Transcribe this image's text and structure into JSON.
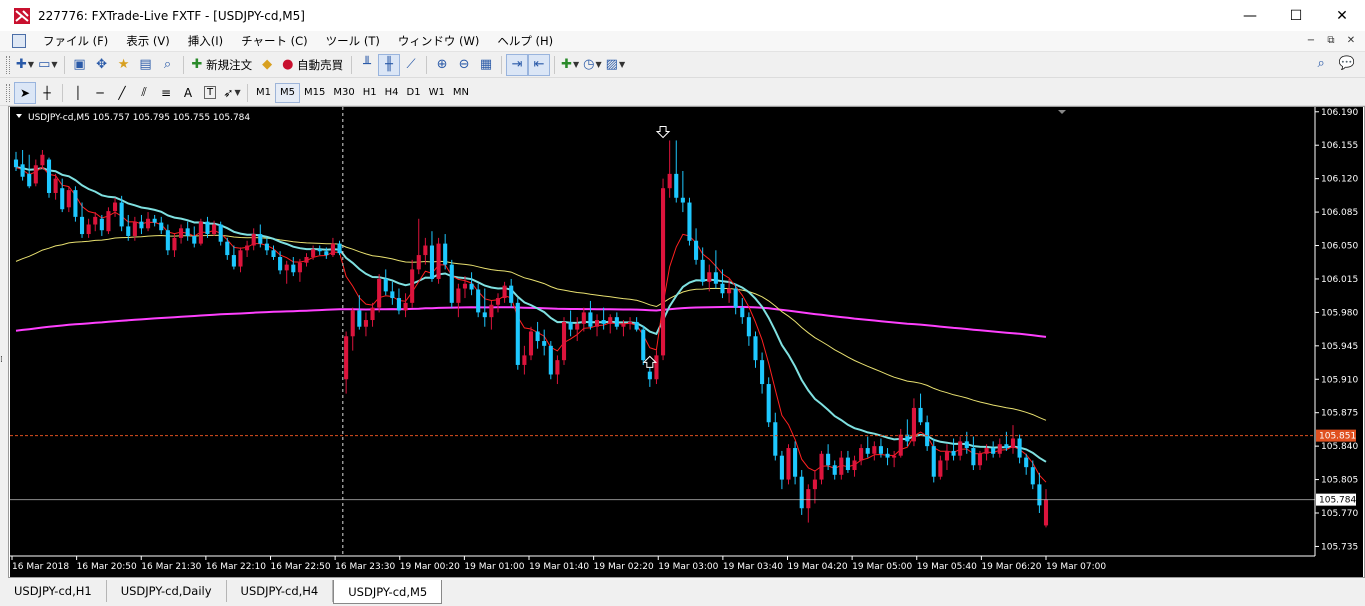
{
  "window": {
    "title": "227776: FXTrade-Live FXTF - [USDJPY-cd,M5]",
    "minimize": "—",
    "maximize": "☐",
    "close": "✕"
  },
  "menu": {
    "items": [
      "ファイル (F)",
      "表示 (V)",
      "挿入(I)",
      "チャート (C)",
      "ツール (T)",
      "ウィンドウ (W)",
      "ヘルプ (H)"
    ],
    "mdi": [
      "−",
      "⧉",
      "✕"
    ]
  },
  "toolbar1": {
    "new_order": "新規注文",
    "auto_trade": "自動売買"
  },
  "toolbar2": {
    "timeframes": [
      "M1",
      "M5",
      "M15",
      "M30",
      "H1",
      "H4",
      "D1",
      "W1",
      "MN"
    ],
    "selected": "M5",
    "tool_letters": [
      "A",
      "T"
    ]
  },
  "tabs": [
    "USDJPY-cd,H1",
    "USDJPY-cd,Daily",
    "USDJPY-cd,H4",
    "USDJPY-cd,M5"
  ],
  "active_tab": "USDJPY-cd,M5",
  "colors": {
    "background": "#000000",
    "bull": "#dc143c",
    "bear": "#1ec8ff",
    "ma_fast": "#ff2020",
    "ma_mid": "#7fe0e0",
    "ma_slow": "#e8e070",
    "ma_long": "#ff40ff",
    "bid_line": "#e05020",
    "ask_line": "#c8c8c8"
  },
  "chart_data": {
    "type": "candlestick",
    "header": "USDJPY-cd,M5  105.757 105.795 105.755 105.784",
    "ylim": [
      105.725,
      106.195
    ],
    "y_ticks": [
      "106.190",
      "106.155",
      "106.120",
      "106.085",
      "106.050",
      "106.015",
      "105.980",
      "105.945",
      "105.910",
      "105.875",
      "105.840",
      "105.805",
      "105.770",
      "105.735"
    ],
    "x_ticks": [
      "16 Mar 2018",
      "16 Mar 20:50",
      "16 Mar 21:30",
      "16 Mar 22:10",
      "16 Mar 22:50",
      "16 Mar 23:30",
      "19 Mar 00:20",
      "19 Mar 01:00",
      "19 Mar 01:40",
      "19 Mar 02:20",
      "19 Mar 03:00",
      "19 Mar 03:40",
      "19 Mar 04:20",
      "19 Mar 05:00",
      "19 Mar 05:40",
      "19 Mar 06:20",
      "19 Mar 07:00"
    ],
    "price_bid_label": "105.851",
    "price_bid": 105.851,
    "price_ask_label": "105.784",
    "price_ask": 105.784,
    "markers": {
      "down_arrow_price": 106.162,
      "up_arrow_price": 105.935
    },
    "candles": [
      [
        106.14,
        106.148,
        106.128,
        106.132
      ],
      [
        106.135,
        106.15,
        106.118,
        106.122
      ],
      [
        106.125,
        106.145,
        106.11,
        106.112
      ],
      [
        106.115,
        106.14,
        106.112,
        106.134
      ],
      [
        106.134,
        106.15,
        106.13,
        106.145
      ],
      [
        106.14,
        106.142,
        106.1,
        106.105
      ],
      [
        106.105,
        106.125,
        106.098,
        106.12
      ],
      [
        106.11,
        106.12,
        106.085,
        106.088
      ],
      [
        106.09,
        106.112,
        106.085,
        106.108
      ],
      [
        106.108,
        106.112,
        106.075,
        106.08
      ],
      [
        106.08,
        106.095,
        106.058,
        106.062
      ],
      [
        106.062,
        106.078,
        106.058,
        106.072
      ],
      [
        106.072,
        106.085,
        106.065,
        106.08
      ],
      [
        106.078,
        106.082,
        106.06,
        106.066
      ],
      [
        106.065,
        106.09,
        106.062,
        106.086
      ],
      [
        106.086,
        106.1,
        106.08,
        106.095
      ],
      [
        106.095,
        106.102,
        106.065,
        106.07
      ],
      [
        106.07,
        106.082,
        106.055,
        106.06
      ],
      [
        106.06,
        106.08,
        106.055,
        106.075
      ],
      [
        106.075,
        106.082,
        106.062,
        106.068
      ],
      [
        106.068,
        106.085,
        106.065,
        106.078
      ],
      [
        106.078,
        106.082,
        106.07,
        106.074
      ],
      [
        106.074,
        106.08,
        106.062,
        106.066
      ],
      [
        106.066,
        106.072,
        106.04,
        106.045
      ],
      [
        106.045,
        106.062,
        106.038,
        106.058
      ],
      [
        106.058,
        106.072,
        106.052,
        106.068
      ],
      [
        106.068,
        106.075,
        106.055,
        106.06
      ],
      [
        106.06,
        106.07,
        106.048,
        106.052
      ],
      [
        106.052,
        106.078,
        106.05,
        106.075
      ],
      [
        106.075,
        106.08,
        106.058,
        106.062
      ],
      [
        106.062,
        106.076,
        106.06,
        106.072
      ],
      [
        106.072,
        106.075,
        106.05,
        106.054
      ],
      [
        106.054,
        106.058,
        106.035,
        106.04
      ],
      [
        106.04,
        106.05,
        106.025,
        106.028
      ],
      [
        106.028,
        106.048,
        106.022,
        106.045
      ],
      [
        106.045,
        106.055,
        106.038,
        106.05
      ],
      [
        106.05,
        106.068,
        106.045,
        106.062
      ],
      [
        106.062,
        106.072,
        106.048,
        106.052
      ],
      [
        106.052,
        106.058,
        106.04,
        106.045
      ],
      [
        106.045,
        106.05,
        106.035,
        106.038
      ],
      [
        106.038,
        106.044,
        106.02,
        106.024
      ],
      [
        106.024,
        106.034,
        106.01,
        106.03
      ],
      [
        106.03,
        106.038,
        106.018,
        106.022
      ],
      [
        106.022,
        106.036,
        106.012,
        106.032
      ],
      [
        106.032,
        106.042,
        106.028,
        106.038
      ],
      [
        106.038,
        106.05,
        106.035,
        106.046
      ],
      [
        106.046,
        106.05,
        106.04,
        106.044
      ],
      [
        106.044,
        106.048,
        106.036,
        106.04
      ],
      [
        106.04,
        106.058,
        106.038,
        106.052
      ],
      [
        106.052,
        106.055,
        106.04,
        106.042
      ],
      [
        105.91,
        105.96,
        105.895,
        105.955
      ],
      [
        105.955,
        105.985,
        105.94,
        105.982
      ],
      [
        105.982,
        105.998,
        105.962,
        105.965
      ],
      [
        105.965,
        105.98,
        105.955,
        105.972
      ],
      [
        105.972,
        105.99,
        105.965,
        105.985
      ],
      [
        105.985,
        106.02,
        105.98,
        106.015
      ],
      [
        106.015,
        106.025,
        105.998,
        106.002
      ],
      [
        106.002,
        106.012,
        105.988,
        105.995
      ],
      [
        105.995,
        106.005,
        105.978,
        105.982
      ],
      [
        105.982,
        106.0,
        105.975,
        105.99
      ],
      [
        105.99,
        106.035,
        105.985,
        106.025
      ],
      [
        106.025,
        106.078,
        106.02,
        106.04
      ],
      [
        106.04,
        106.058,
        106.03,
        106.05
      ],
      [
        106.05,
        106.065,
        106.012,
        106.015
      ],
      [
        106.015,
        106.058,
        106.01,
        106.052
      ],
      [
        106.052,
        106.062,
        106.025,
        106.03
      ],
      [
        106.03,
        106.035,
        105.985,
        105.99
      ],
      [
        105.99,
        106.01,
        105.975,
        106.005
      ],
      [
        106.005,
        106.018,
        105.995,
        106.01
      ],
      [
        106.01,
        106.022,
        105.998,
        106.004
      ],
      [
        106.004,
        106.01,
        105.975,
        105.98
      ],
      [
        105.98,
        106.005,
        105.965,
        105.975
      ],
      [
        105.975,
        105.992,
        105.962,
        105.988
      ],
      [
        105.988,
        106.0,
        105.98,
        105.995
      ],
      [
        105.995,
        106.012,
        105.99,
        106.008
      ],
      [
        106.008,
        106.015,
        105.985,
        105.99
      ],
      [
        105.99,
        105.995,
        105.92,
        105.925
      ],
      [
        105.925,
        105.945,
        105.915,
        105.935
      ],
      [
        105.935,
        105.965,
        105.93,
        105.96
      ],
      [
        105.96,
        105.97,
        105.942,
        105.95
      ],
      [
        105.95,
        105.962,
        105.935,
        105.945
      ],
      [
        105.945,
        105.95,
        105.91,
        105.915
      ],
      [
        105.915,
        105.935,
        105.905,
        105.93
      ],
      [
        105.93,
        105.975,
        105.925,
        105.97
      ],
      [
        105.97,
        105.982,
        105.955,
        105.962
      ],
      [
        105.962,
        105.975,
        105.95,
        105.968
      ],
      [
        105.968,
        105.985,
        105.96,
        105.98
      ],
      [
        105.98,
        105.992,
        105.962,
        105.965
      ],
      [
        105.965,
        105.978,
        105.955,
        105.972
      ],
      [
        105.972,
        105.985,
        105.962,
        105.968
      ],
      [
        105.968,
        105.978,
        105.958,
        105.975
      ],
      [
        105.975,
        105.98,
        105.962,
        105.965
      ],
      [
        105.965,
        105.972,
        105.955,
        105.968
      ],
      [
        105.968,
        105.975,
        105.962,
        105.97
      ],
      [
        105.97,
        105.975,
        105.96,
        105.962
      ],
      [
        105.962,
        105.966,
        105.925,
        105.93
      ],
      [
        105.918,
        105.922,
        105.902,
        105.91
      ],
      [
        105.91,
        105.94,
        105.905,
        105.935
      ],
      [
        105.935,
        106.12,
        105.93,
        106.11
      ],
      [
        106.11,
        106.16,
        106.1,
        106.125
      ],
      [
        106.125,
        106.16,
        106.095,
        106.1
      ],
      [
        106.1,
        106.128,
        106.085,
        106.095
      ],
      [
        106.095,
        106.1,
        106.05,
        106.055
      ],
      [
        106.055,
        106.068,
        106.03,
        106.035
      ],
      [
        106.035,
        106.048,
        106.008,
        106.012
      ],
      [
        106.012,
        106.03,
        106.002,
        106.022
      ],
      [
        106.022,
        106.045,
        106.005,
        106.01
      ],
      [
        106.01,
        106.025,
        105.995,
        106.0
      ],
      [
        106.0,
        106.015,
        105.99,
        106.005
      ],
      [
        106.005,
        106.01,
        105.978,
        105.985
      ],
      [
        105.985,
        105.995,
        105.968,
        105.975
      ],
      [
        105.975,
        105.98,
        105.945,
        105.955
      ],
      [
        105.955,
        105.96,
        105.922,
        105.93
      ],
      [
        105.93,
        105.938,
        105.895,
        105.905
      ],
      [
        105.905,
        105.912,
        105.86,
        105.865
      ],
      [
        105.865,
        105.875,
        105.825,
        105.83
      ],
      [
        105.83,
        105.835,
        105.795,
        105.805
      ],
      [
        105.805,
        105.842,
        105.8,
        105.838
      ],
      [
        105.838,
        105.845,
        105.8,
        105.808
      ],
      [
        105.808,
        105.815,
        105.768,
        105.775
      ],
      [
        105.775,
        105.8,
        105.76,
        105.795
      ],
      [
        105.795,
        105.815,
        105.78,
        105.805
      ],
      [
        105.805,
        105.835,
        105.8,
        105.832
      ],
      [
        105.832,
        105.842,
        105.815,
        105.82
      ],
      [
        105.82,
        105.825,
        105.805,
        105.81
      ],
      [
        105.81,
        105.835,
        105.805,
        105.828
      ],
      [
        105.828,
        105.835,
        105.812,
        105.815
      ],
      [
        105.815,
        105.83,
        105.808,
        105.825
      ],
      [
        105.825,
        105.842,
        105.82,
        105.838
      ],
      [
        105.838,
        105.85,
        105.828,
        105.832
      ],
      [
        105.832,
        105.845,
        105.825,
        105.84
      ],
      [
        105.84,
        105.848,
        105.828,
        105.832
      ],
      [
        105.832,
        105.838,
        105.82,
        105.828
      ],
      [
        105.828,
        105.835,
        105.818,
        105.83
      ],
      [
        105.83,
        105.858,
        105.828,
        105.852
      ],
      [
        105.852,
        105.868,
        105.84,
        105.845
      ],
      [
        105.845,
        105.89,
        105.84,
        105.88
      ],
      [
        105.88,
        105.895,
        105.862,
        105.865
      ],
      [
        105.865,
        105.872,
        105.835,
        105.84
      ],
      [
        105.84,
        105.848,
        105.802,
        105.808
      ],
      [
        105.808,
        105.83,
        105.805,
        105.825
      ],
      [
        105.825,
        105.842,
        105.815,
        105.835
      ],
      [
        105.835,
        105.848,
        105.825,
        105.83
      ],
      [
        105.83,
        105.85,
        105.825,
        105.845
      ],
      [
        105.845,
        105.855,
        105.832,
        105.838
      ],
      [
        105.838,
        105.85,
        105.815,
        105.82
      ],
      [
        105.82,
        105.835,
        105.815,
        105.832
      ],
      [
        105.832,
        105.842,
        105.825,
        105.838
      ],
      [
        105.838,
        105.845,
        105.828,
        105.832
      ],
      [
        105.832,
        105.848,
        105.828,
        105.842
      ],
      [
        105.842,
        105.855,
        105.835,
        105.838
      ],
      [
        105.838,
        105.862,
        105.832,
        105.848
      ],
      [
        105.848,
        105.852,
        105.822,
        105.828
      ],
      [
        105.828,
        105.832,
        105.81,
        105.818
      ],
      [
        105.818,
        105.825,
        105.795,
        105.8
      ],
      [
        105.8,
        105.812,
        105.77,
        105.778
      ],
      [
        105.757,
        105.795,
        105.755,
        105.784
      ]
    ]
  }
}
